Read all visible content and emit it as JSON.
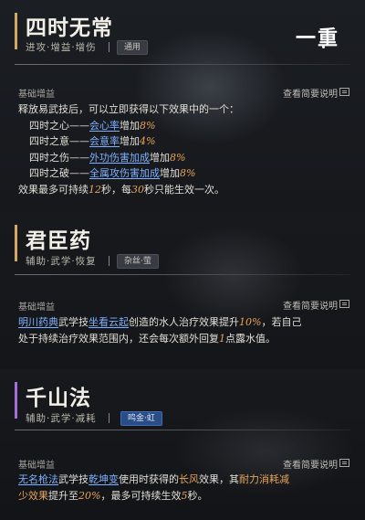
{
  "skills": [
    {
      "name": "四时无常",
      "tags": "进攻·增益·增伤",
      "badge": "通用",
      "level": "一重",
      "section_label": "基础增益",
      "view_brief": "查看简要说明",
      "desc": {
        "intro": "释放易武技后，可以立即获得以下效果中的一个：",
        "items": [
          {
            "prefix": "四时之心——",
            "stat": "会心率",
            "mid": "增加",
            "value": "8%"
          },
          {
            "prefix": "四时之意——",
            "stat": "会意率",
            "mid": "增加",
            "value": "4%"
          },
          {
            "prefix": "四时之伤——",
            "stat": "外功伤害加成",
            "mid": "增加",
            "value": "8%"
          },
          {
            "prefix": "四时之破——",
            "stat": "全属攻伤害加成",
            "mid": "增加",
            "value": "8%"
          }
        ],
        "tail": {
          "a": "效果最多可持续",
          "n1": "12",
          "b": "秒，每",
          "n2": "30",
          "c": "秒只能生效一次。"
        }
      }
    },
    {
      "name": "君臣药",
      "tags": "辅助·武学·恢复",
      "badge": "杂丝·萤",
      "section_label": "基础增益",
      "view_brief": "查看简要说明",
      "desc": {
        "l1": {
          "link1": "明川药典",
          "a": "武学技",
          "link2": "坐看云起",
          "b": "创造的水人治疗效果提升",
          "num": "10%",
          "c": "，若自己"
        },
        "l2": {
          "a": "处于持续治疗效果范围内，还会每次额外回复",
          "num": "1",
          "b": "点露水值。"
        }
      }
    },
    {
      "name": "千山法",
      "tags": "辅助·武学·减耗",
      "badge": "鸣金·虹",
      "section_label": "基础增益",
      "view_brief": "查看简要说明",
      "desc": {
        "l1": {
          "link1": "无名枪法",
          "a": "武学技",
          "link2": "乾坤变",
          "b": "使用时获得的",
          "hl1": "长风",
          "c": "效果，其",
          "hl2": "耐力消耗减"
        },
        "l2": {
          "hl": "少效果",
          "a": "提升至",
          "num": "20%",
          "b": "，最多可持续生效",
          "num2": "5",
          "c": "秒。"
        }
      }
    }
  ],
  "colors": {
    "accent_gold": "#d3a862",
    "accent_purple": "#a56ed6",
    "link_blue": "#7fb1ff",
    "highlight_orange": "#e8a45a",
    "badge_blue": "#2b4d86"
  }
}
